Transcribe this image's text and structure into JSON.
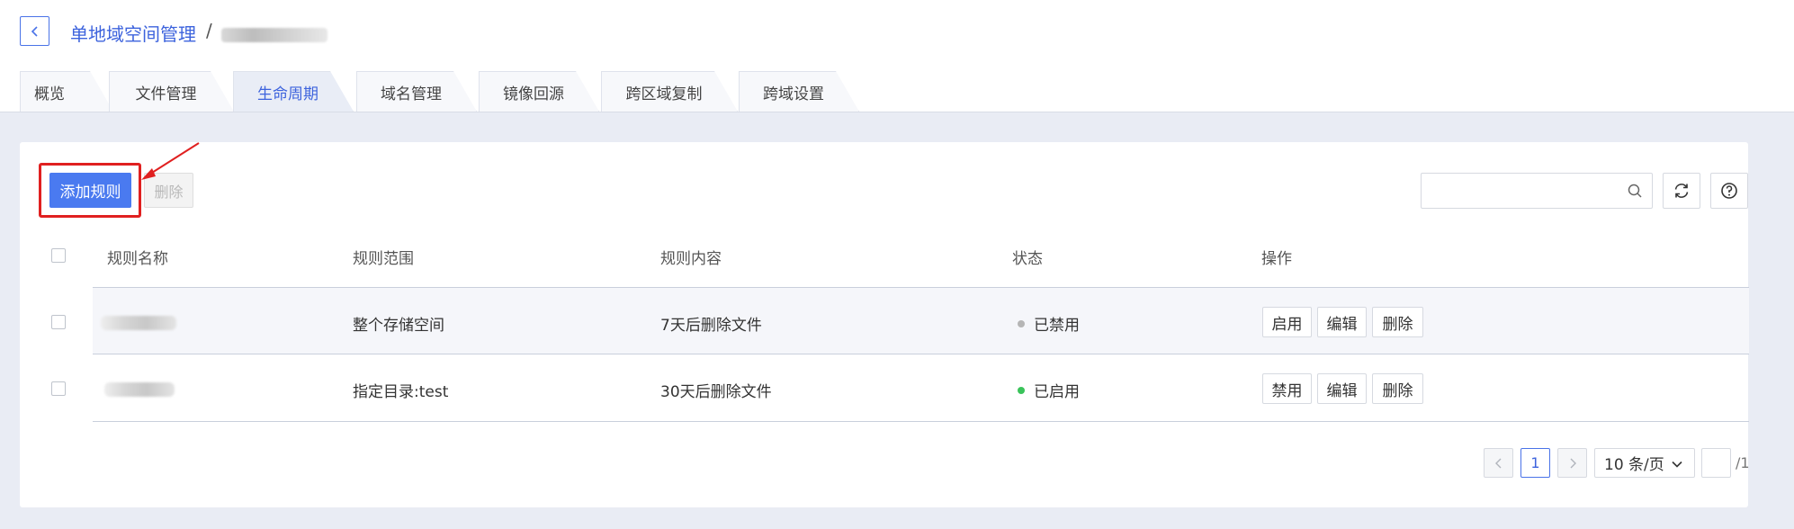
{
  "breadcrumb": {
    "parent": "单地域空间管理",
    "separator": "/",
    "current": "",
    "current_redacted": true
  },
  "tabs": [
    {
      "label": "概览",
      "active": false
    },
    {
      "label": "文件管理",
      "active": false
    },
    {
      "label": "生命周期",
      "active": true
    },
    {
      "label": "域名管理",
      "active": false
    },
    {
      "label": "镜像回源",
      "active": false
    },
    {
      "label": "跨区域复制",
      "active": false
    },
    {
      "label": "跨域设置",
      "active": false
    }
  ],
  "toolbar": {
    "add_label": "添加规则",
    "delete_label": "删除",
    "search_placeholder": ""
  },
  "table": {
    "columns": [
      "规则名称",
      "规则范围",
      "规则内容",
      "状态",
      "操作"
    ],
    "rows": [
      {
        "name": "",
        "name_redacted": true,
        "scope": "整个存储空间",
        "content": "7天后删除文件",
        "status": "已禁用",
        "status_color": "#b5b5b5",
        "actions": [
          "启用",
          "编辑",
          "删除"
        ]
      },
      {
        "name": "",
        "name_redacted": true,
        "scope": "指定目录:test",
        "content": "30天后删除文件",
        "status": "已启用",
        "status_color": "#3ac35a",
        "actions": [
          "禁用",
          "编辑",
          "删除"
        ]
      }
    ]
  },
  "pagination": {
    "current_page": "1",
    "page_size": "10 条/页",
    "total_pages": "/1"
  },
  "colors": {
    "accent": "#3d63dd",
    "primary_button": "#4a7af0",
    "highlight": "#e02020"
  }
}
